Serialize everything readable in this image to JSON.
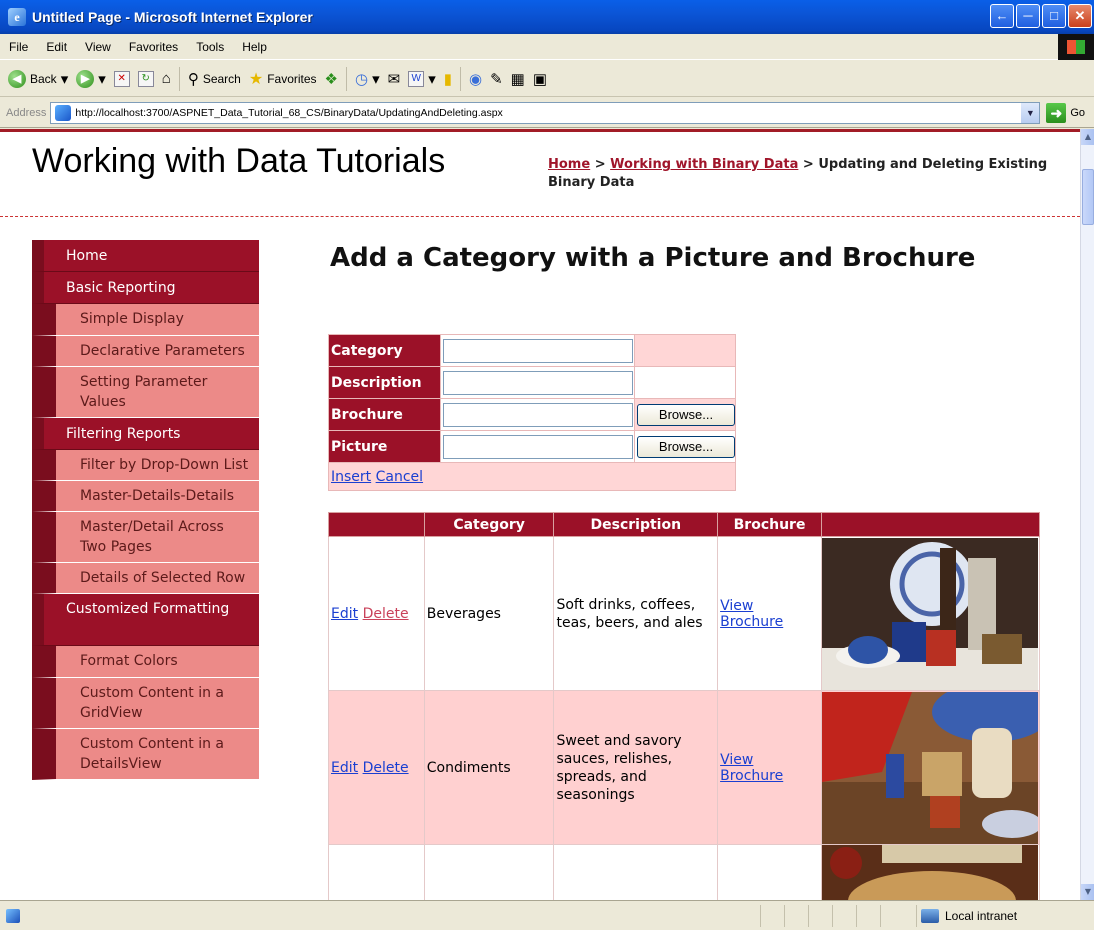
{
  "window": {
    "title": "Untitled Page - Microsoft Internet Explorer",
    "buttons": [
      "←",
      "─",
      "□",
      "✕"
    ]
  },
  "menubar": [
    "File",
    "Edit",
    "View",
    "Favorites",
    "Tools",
    "Help"
  ],
  "toolbar": {
    "back_label": "Back",
    "search_label": "Search",
    "favorites_label": "Favorites"
  },
  "address": {
    "label": "Address",
    "url": "http://localhost:3700/ASPNET_Data_Tutorial_68_CS/BinaryData/UpdatingAndDeleting.aspx",
    "go_label": "Go"
  },
  "site": {
    "title": "Working with Data Tutorials",
    "breadcrumb": {
      "home": "Home",
      "sep1": " > ",
      "section": "Working with Binary Data",
      "sep2": " > ",
      "current": "Updating and Deleting Existing Binary Data"
    }
  },
  "sidebar": {
    "items": [
      {
        "label": "Home",
        "level": "top"
      },
      {
        "label": "Basic Reporting",
        "level": "top"
      },
      {
        "label": "Simple Display",
        "level": "sub"
      },
      {
        "label": "Declarative Parameters",
        "level": "sub"
      },
      {
        "label": "Setting Parameter Values",
        "level": "sub"
      },
      {
        "label": "Filtering Reports",
        "level": "top"
      },
      {
        "label": "Filter by Drop-Down List",
        "level": "sub"
      },
      {
        "label": "Master-Details-Details",
        "level": "sub"
      },
      {
        "label": "Master/Detail Across Two Pages",
        "level": "sub"
      },
      {
        "label": "Details of Selected Row",
        "level": "sub"
      },
      {
        "label": "Customized Formatting",
        "level": "top"
      },
      {
        "label": "Format Colors",
        "level": "sub"
      },
      {
        "label": "Custom Content in a GridView",
        "level": "sub"
      },
      {
        "label": "Custom Content in a DetailsView",
        "level": "sub"
      }
    ]
  },
  "main": {
    "heading": "Add a Category with a Picture and Brochure",
    "form": {
      "category_label": "Category",
      "category_value": "",
      "description_label": "Description",
      "description_value": "",
      "brochure_label": "Brochure",
      "picture_label": "Picture",
      "browse_label": "Browse...",
      "insert_label": "Insert",
      "cancel_label": "Cancel"
    },
    "grid": {
      "headers": [
        "",
        "Category",
        "Description",
        "Brochure",
        ""
      ],
      "rows": [
        {
          "edit": "Edit",
          "delete": "Delete",
          "category": "Beverages",
          "description": "Soft drinks, coffees, teas, beers, and ales",
          "brochure": "View Brochure"
        },
        {
          "edit": "Edit",
          "delete": "Delete",
          "category": "Condiments",
          "description": "Sweet and savory sauces, relishes, spreads, and seasonings",
          "brochure": "View Brochure"
        }
      ]
    }
  },
  "status": {
    "zone": "Local intranet"
  },
  "colors": {
    "accent": "#9b1128",
    "nav_sub": "#ec8a88",
    "row_alt": "#ffd0d0",
    "link": "#1a3fd1"
  }
}
